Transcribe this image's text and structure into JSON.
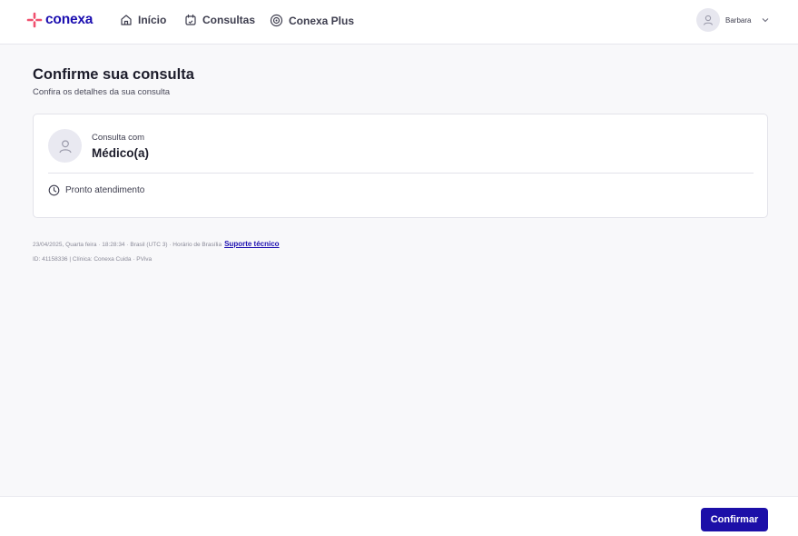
{
  "brand": {
    "logo_text": "conexa",
    "primary_color": "#1c0fb0",
    "logo_accent_color": "#f0506e"
  },
  "nav": {
    "items": [
      {
        "label": "Início",
        "icon": "home-icon"
      },
      {
        "label": "Consultas",
        "icon": "calendar-icon"
      },
      {
        "label": "Conexa Plus",
        "icon": "target-icon"
      }
    ]
  },
  "user": {
    "name": "Barbara",
    "icon": "user-icon"
  },
  "page": {
    "title": "Confirme sua consulta",
    "subtitle": "Confira os detalhes da sua consulta"
  },
  "appointment": {
    "label": "Consulta com",
    "doctor": "Médico(a)",
    "timing": "Pronto atendimento",
    "timing_icon": "clock-icon"
  },
  "meta": {
    "datetime": "23/04/2025, Quarta feira · 18:28:34 · Brasil (UTC 3) · Horário de Brasília",
    "support_link": "Suporte técnico",
    "ids": "ID: 41158336 | Clínica: Conexa Cuida · PViva"
  },
  "footer": {
    "confirm_label": "Confirmar"
  }
}
